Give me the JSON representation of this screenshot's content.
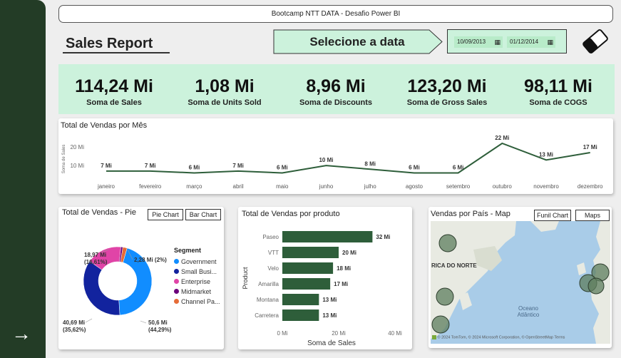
{
  "header": {
    "title": "Bootcamp NTT DATA - Desafio Power BI"
  },
  "report": {
    "title": "Sales Report"
  },
  "date_selector": {
    "label": "Selecione a data",
    "start": "10/09/2013",
    "end": "01/12/2014"
  },
  "kpis": [
    {
      "value": "114,24 Mi",
      "label": "Soma de  Sales"
    },
    {
      "value": "1,08 Mi",
      "label": "Soma de Units Sold"
    },
    {
      "value": "8,96 Mi",
      "label": "Soma de Discounts"
    },
    {
      "value": "123,20 Mi",
      "label": "Soma de Gross Sales"
    },
    {
      "value": "98,11 Mi",
      "label": "Soma de COGS"
    }
  ],
  "line_card": {
    "title": "Total de Vendas por Mês"
  },
  "pie_card": {
    "title": "Total de Vendas - Pie",
    "btn_pie": "Pie Chart",
    "btn_bar": "Bar Chart",
    "legend_title": "Segment"
  },
  "bar_card": {
    "title": "Total de Vendas por produto"
  },
  "map_card": {
    "title": "Vendas por País - Map",
    "btn_funnel": "Funil Chart",
    "btn_maps": "Maps",
    "label_na": "RICA DO NORTE",
    "label_ocean1": "Oceano",
    "label_ocean2": "Atlântico",
    "attribution": "© 2024 TomTom, © 2024 Microsoft Corporation, © OpenStreetMap  Terms",
    "brand": "Microsoft Bing"
  },
  "chart_data": [
    {
      "type": "line",
      "title": "Total de Vendas por Mês",
      "ylabel": "Soma de Sales",
      "categories": [
        "janeiro",
        "fevereiro",
        "março",
        "abril",
        "maio",
        "junho",
        "julho",
        "agosto",
        "setembro",
        "outubro",
        "novembro",
        "dezembro"
      ],
      "values": [
        7,
        7,
        6,
        7,
        6,
        10,
        8,
        6,
        6,
        22,
        13,
        17
      ],
      "data_labels": [
        "7 Mi",
        "7 Mi",
        "6 Mi",
        "7 Mi",
        "6 Mi",
        "10 Mi",
        "8 Mi",
        "6 Mi",
        "6 Mi",
        "22 Mi",
        "13 Mi",
        "17 Mi"
      ],
      "yticks": [
        "10 Mi",
        "20 Mi"
      ],
      "ytick_values": [
        10,
        20
      ],
      "ylim": [
        0,
        27
      ],
      "color": "#2e5e3a"
    },
    {
      "type": "pie",
      "title": "Total de Vendas - Pie",
      "legend_title": "Segment",
      "slices": [
        {
          "name": "Government",
          "value": 50.6,
          "label": "50,6 Mi",
          "pct": "(44,29%)",
          "color": "#118dff"
        },
        {
          "name": "Small Busi...",
          "value": 40.69,
          "label": "40,69 Mi",
          "pct": "(35,62%)",
          "color": "#12239e"
        },
        {
          "name": "Enterprise",
          "value": 18.97,
          "label": "18,97 Mi",
          "pct": "(16,61%)",
          "color": "#e044a7"
        },
        {
          "name": "Midmarket",
          "value": 1.1,
          "label": "",
          "pct": "",
          "color": "#6b007b"
        },
        {
          "name": "Channel Pa...",
          "value": 2.28,
          "label": "2,28 Mi (2%)",
          "pct": "",
          "color": "#e66c37"
        }
      ]
    },
    {
      "type": "bar",
      "title": "Total de Vendas por produto",
      "xlabel": "Soma de Sales",
      "ylabel": "Product",
      "categories": [
        "Paseo",
        "VTT",
        "Velo",
        "Amarilla",
        "Montana",
        "Carretera"
      ],
      "values": [
        32,
        20,
        18,
        17,
        13,
        13
      ],
      "data_labels": [
        "32 Mi",
        "20 Mi",
        "18 Mi",
        "17 Mi",
        "13 Mi",
        "13 Mi"
      ],
      "xticks": [
        "0 Mi",
        "20 Mi",
        "40 Mi"
      ],
      "xtick_values": [
        0,
        20,
        40
      ],
      "xlim": [
        0,
        40
      ],
      "color": "#2e5e3a"
    }
  ]
}
